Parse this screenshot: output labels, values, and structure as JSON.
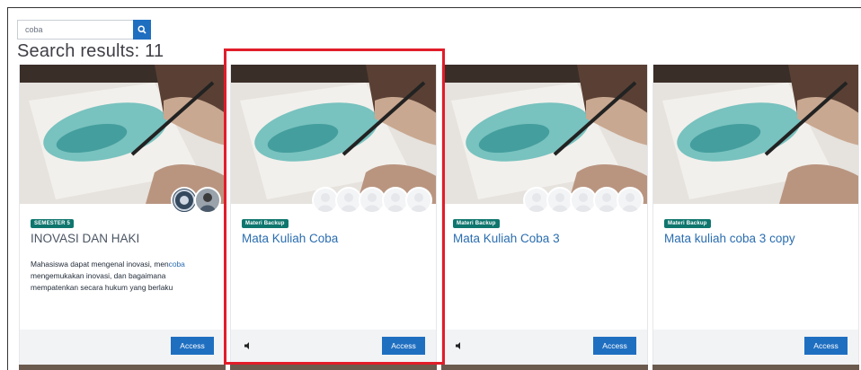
{
  "search": {
    "value": "coba",
    "placeholder": ""
  },
  "results_title": "Search results: 11",
  "cards": [
    {
      "badge": "SEMESTER 5",
      "title": "INOVASI DAN HAKI",
      "description_before": "Mahasiswa dapat mengenal inovasi, men",
      "description_highlight": "coba",
      "description_after": " mengemukakan inovasi, dan bagaimana mempatenkan secara hukum yang berlaku",
      "button": "Access"
    },
    {
      "badge": "Materi Backup",
      "title": "Mata Kuliah Coba",
      "button": "Access"
    },
    {
      "badge": "Materi Backup",
      "title": "Mata Kuliah Coba 3",
      "button": "Access"
    },
    {
      "badge": "Materi Backup",
      "title": "Mata kuliah coba 3 copy",
      "button": "Access"
    }
  ],
  "colors": {
    "primary": "#1f6fc1",
    "badge": "#0f766e",
    "link": "#2a6db0",
    "highlight": "#e11d2a"
  },
  "icons": {
    "search": "search-icon",
    "speaker": "speaker-icon",
    "avatar": "user-avatar-icon"
  }
}
